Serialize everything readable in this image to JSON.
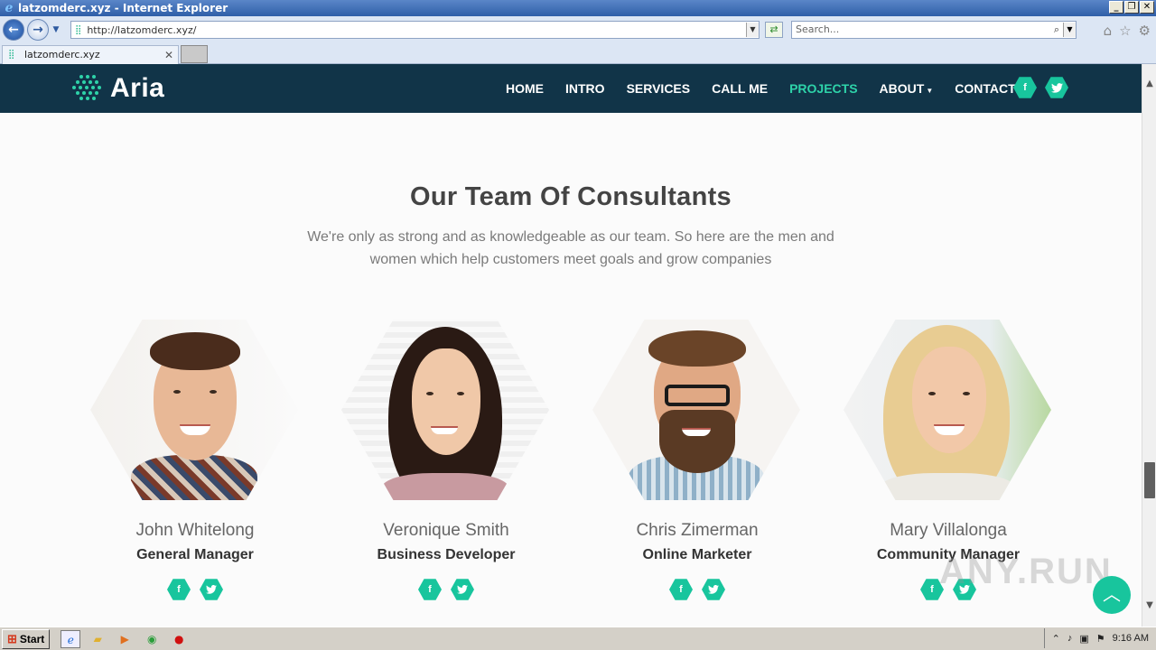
{
  "browser": {
    "window_title": "latzomderc.xyz - Internet Explorer",
    "url": "http://latzomderc.xyz/",
    "search_placeholder": "Search...",
    "tab_title": "latzomderc.xyz"
  },
  "site": {
    "logo_text": "Aria",
    "nav": {
      "home": "HOME",
      "intro": "INTRO",
      "services": "SERVICES",
      "callme": "CALL ME",
      "projects": "PROJECTS",
      "about": "ABOUT",
      "contact": "CONTACT"
    },
    "active_nav": "PROJECTS",
    "accent_color": "#18c59d",
    "nav_bg_color": "#113448"
  },
  "team": {
    "title": "Our Team Of Consultants",
    "subtitle": "We're only as strong and as knowledgeable as our team. So here are the men and women which help customers meet goals and grow companies",
    "members": [
      {
        "name": "John Whitelong",
        "role": "General Manager"
      },
      {
        "name": "Veronique Smith",
        "role": "Business Developer"
      },
      {
        "name": "Chris Zimerman",
        "role": "Online Marketer"
      },
      {
        "name": "Mary Villalonga",
        "role": "Community Manager"
      }
    ]
  },
  "social": {
    "facebook": "f",
    "twitter": "t"
  },
  "watermark": "ANY.RUN",
  "taskbar": {
    "start_label": "Start",
    "clock": "9:16 AM"
  }
}
